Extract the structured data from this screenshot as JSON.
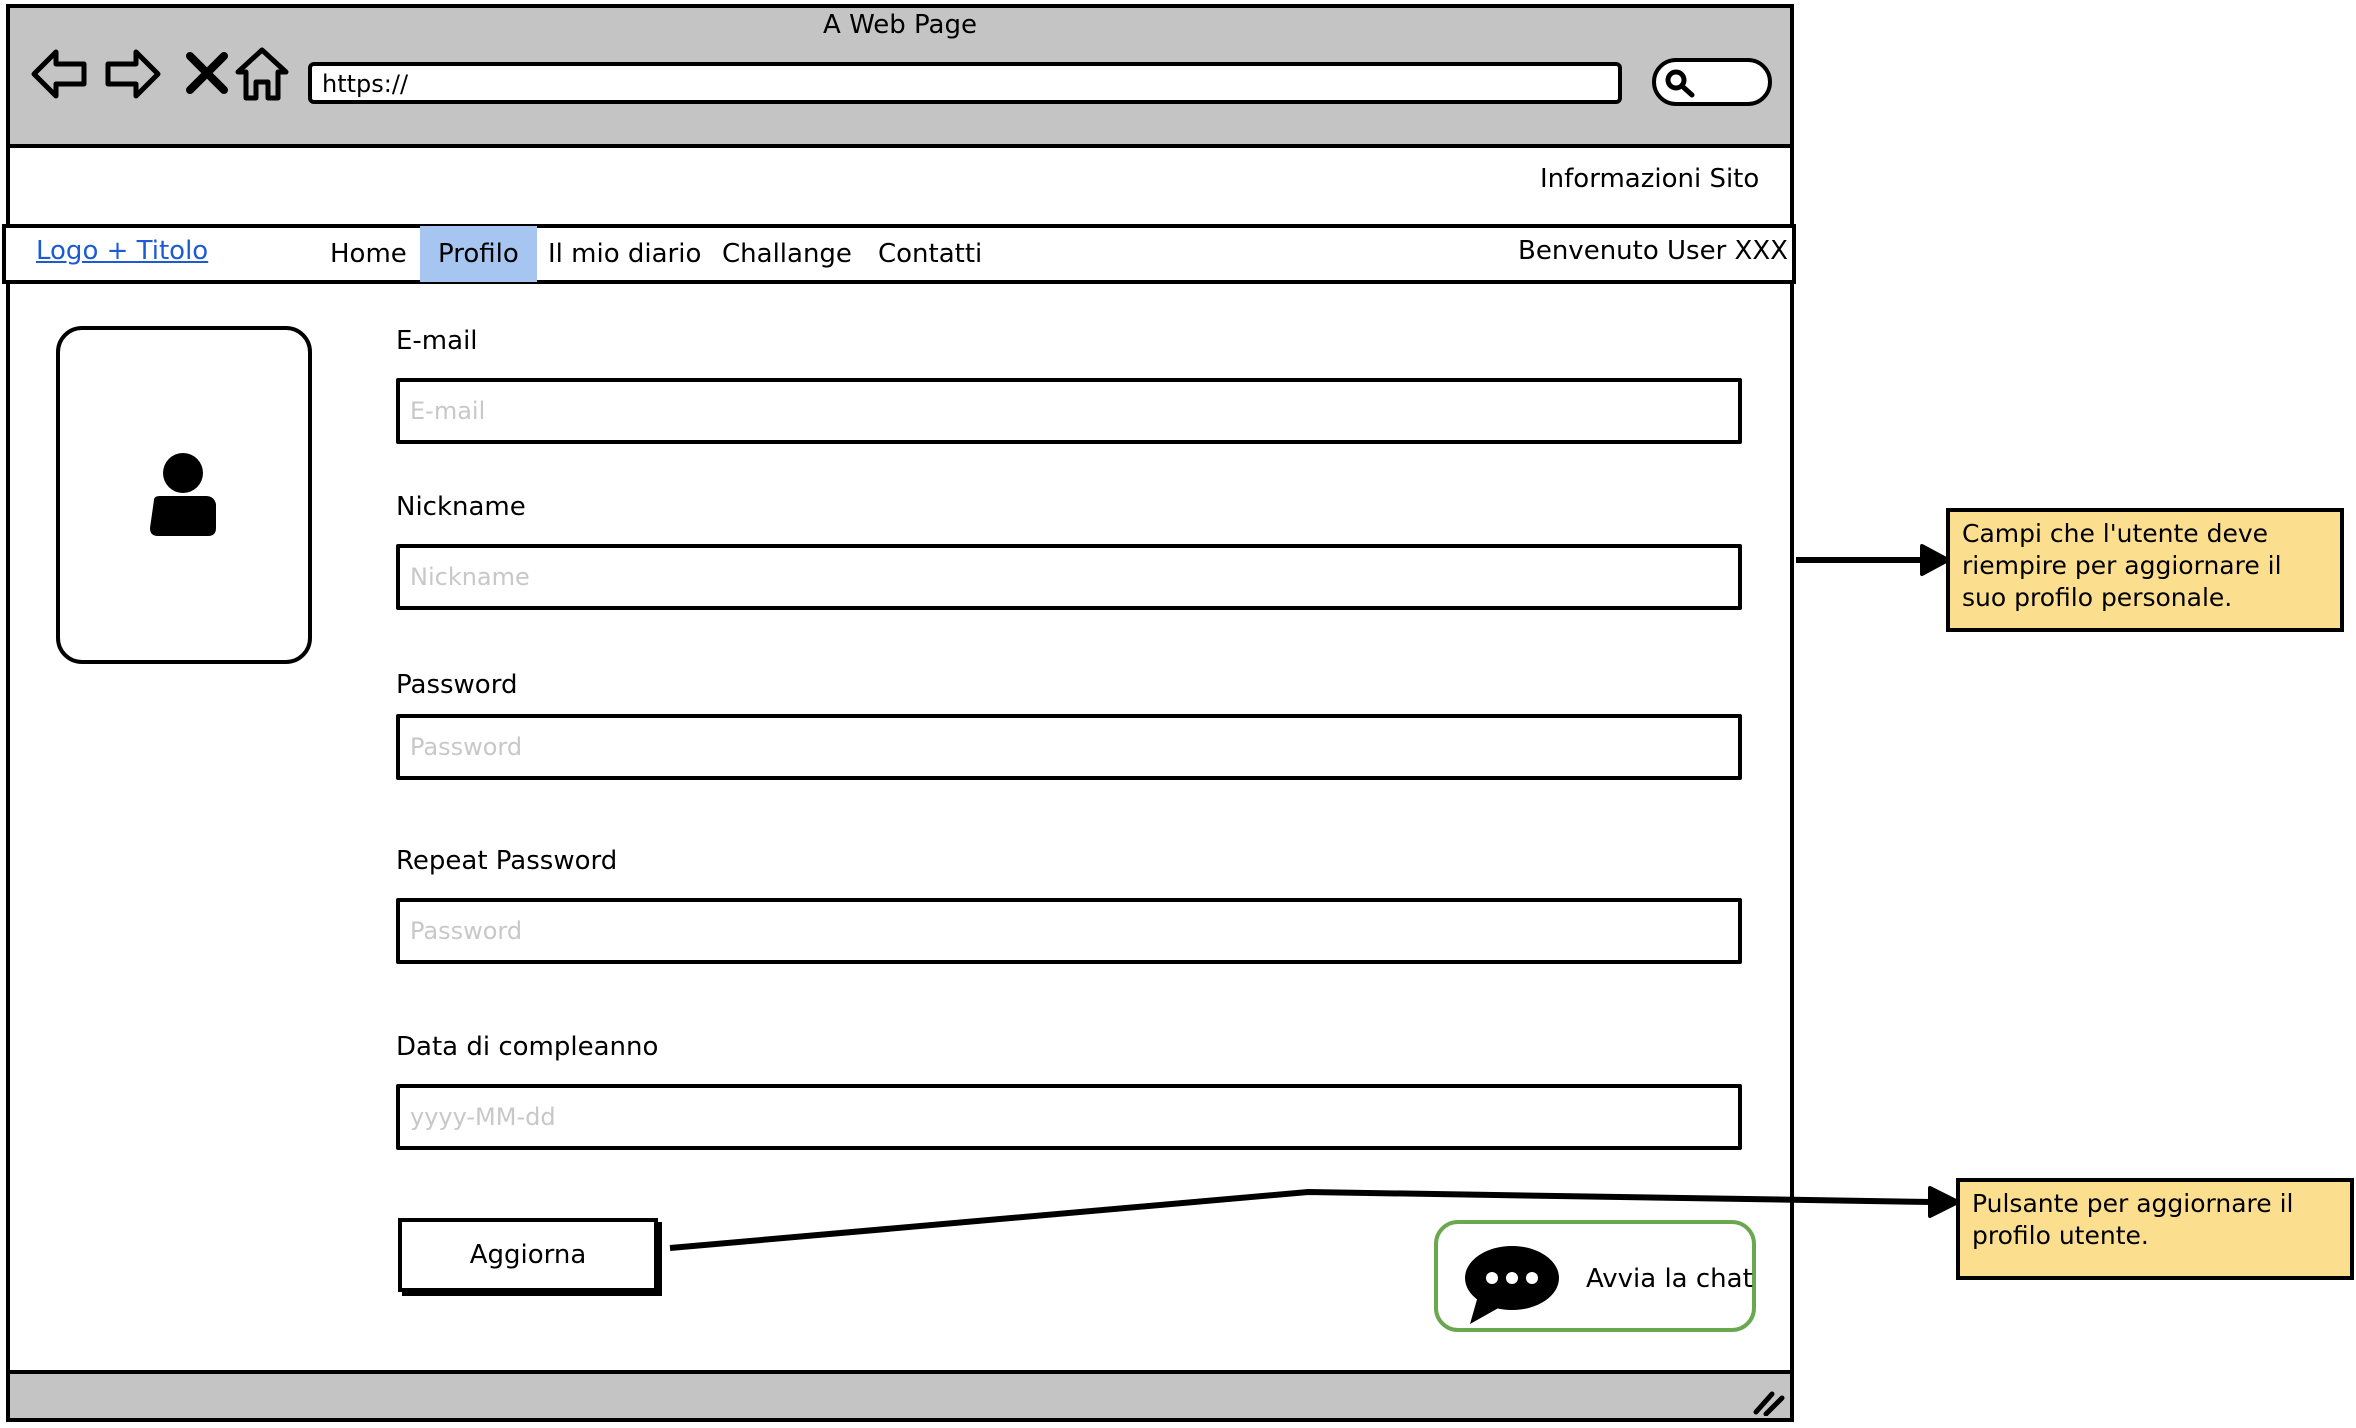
{
  "window": {
    "title": "A Web Page"
  },
  "address_bar": {
    "url": "https://"
  },
  "icons": {
    "back": "back-arrow-icon",
    "forward": "forward-arrow-icon",
    "stop": "close-icon",
    "home": "home-icon",
    "search": "search-icon",
    "avatar": "user-icon",
    "chat": "speech-bubble-icon",
    "resize": "resize-grip-icon"
  },
  "header": {
    "site_info": "Informazioni Sito"
  },
  "navbar": {
    "logo": "Logo + Titolo",
    "items": [
      {
        "label": "Home",
        "active": false
      },
      {
        "label": "Profilo",
        "active": true
      },
      {
        "label": "Il mio diario",
        "active": false
      },
      {
        "label": "Challange",
        "active": false
      },
      {
        "label": "Contatti",
        "active": false
      }
    ],
    "welcome": "Benvenuto User XXX"
  },
  "form": {
    "fields": [
      {
        "label": "E-mail",
        "placeholder": "E-mail",
        "value": ""
      },
      {
        "label": "Nickname",
        "placeholder": "Nickname",
        "value": ""
      },
      {
        "label": "Password",
        "placeholder": "Password",
        "value": ""
      },
      {
        "label": "Repeat Password",
        "placeholder": "Password",
        "value": ""
      },
      {
        "label": "Data di compleanno",
        "placeholder": "yyyy-MM-dd",
        "value": ""
      }
    ],
    "submit_label": "Aggiorna"
  },
  "chat": {
    "label": "Avvia la chat"
  },
  "notes": [
    {
      "text": "Campi che l'utente deve riempire per aggiornare il suo profilo personale."
    },
    {
      "text": "Pulsante per aggiornare il profilo utente."
    }
  ],
  "colors": {
    "chrome_gray": "#c4c4c4",
    "active_tab": "#a6c5f0",
    "link_blue": "#1d5bd6",
    "note_yellow": "#fcde8f",
    "chat_border_green": "#6aa84f"
  }
}
